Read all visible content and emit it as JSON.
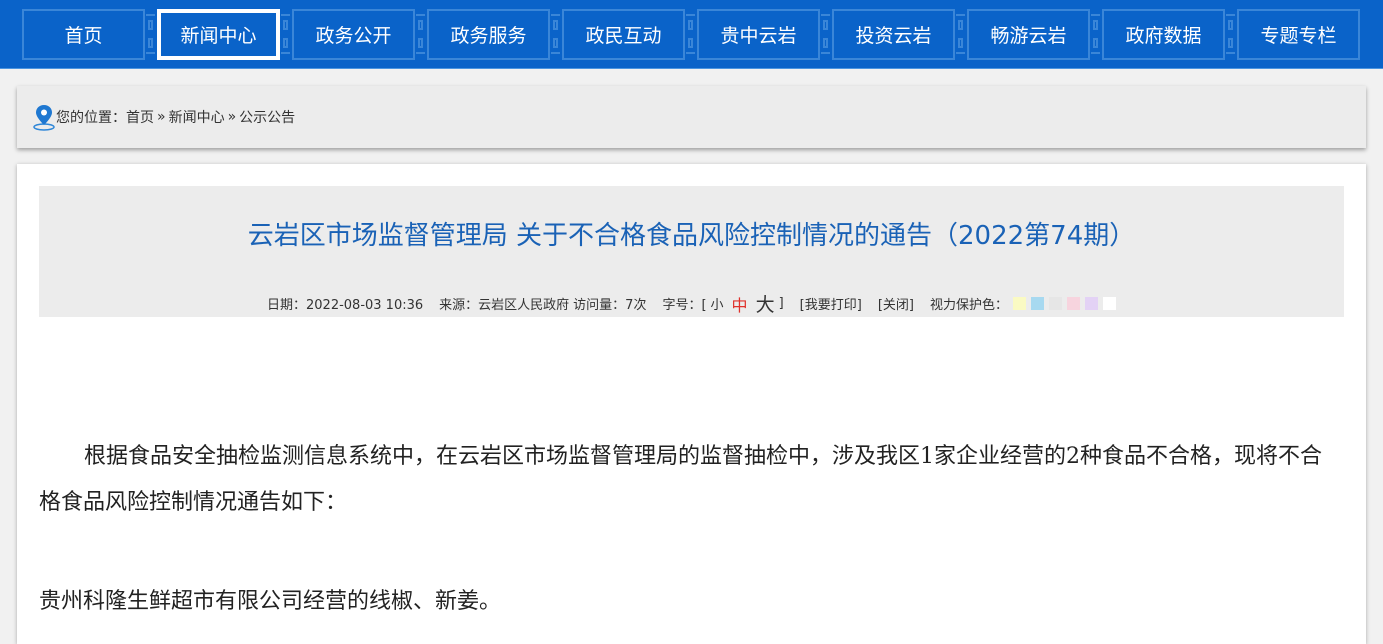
{
  "nav": {
    "items": [
      {
        "label": "首页"
      },
      {
        "label": "新闻中心"
      },
      {
        "label": "政务公开"
      },
      {
        "label": "政务服务"
      },
      {
        "label": "政民互动"
      },
      {
        "label": "贵中云岩"
      },
      {
        "label": "投资云岩"
      },
      {
        "label": "畅游云岩"
      },
      {
        "label": "政府数据"
      },
      {
        "label": "专题专栏"
      }
    ]
  },
  "breadcrumb": {
    "label": "您的位置：",
    "items": [
      "首页",
      "新闻中心",
      "公示公告"
    ],
    "separator": "»"
  },
  "article": {
    "title": "云岩区市场监督管理局 关于不合格食品风险控制情况的通告（2022第74期）",
    "meta": {
      "date": "日期：2022-08-03 10:36",
      "source": "来源：云岩区人民政府",
      "visits": "访问量：7次",
      "font_size_label": "字号：[",
      "font_small": "小",
      "font_medium": "中",
      "font_large": "大",
      "font_size_close": "]",
      "print": "[我要打印]",
      "close": "[关闭]",
      "eye_care_label": "视力保护色："
    },
    "eye_care_colors": [
      "#fafac3",
      "#a7d9f0",
      "#e6e6e6",
      "#f7d4de",
      "#e3d2f5",
      "#ffffff"
    ],
    "paragraph1": "根据食品安全抽检监测信息系统中，在云岩区市场监督管理局的监督抽检中，涉及我区1家企业经营的2种食品不合格，现将不合格食品风险控制情况通告如下：",
    "paragraph2": "贵州科隆生鲜超市有限公司经营的线椒、新姜。"
  },
  "colors": {
    "nav_bg": "#0a63c9",
    "title": "#1a62b6",
    "accent_red": "#e0312b"
  }
}
